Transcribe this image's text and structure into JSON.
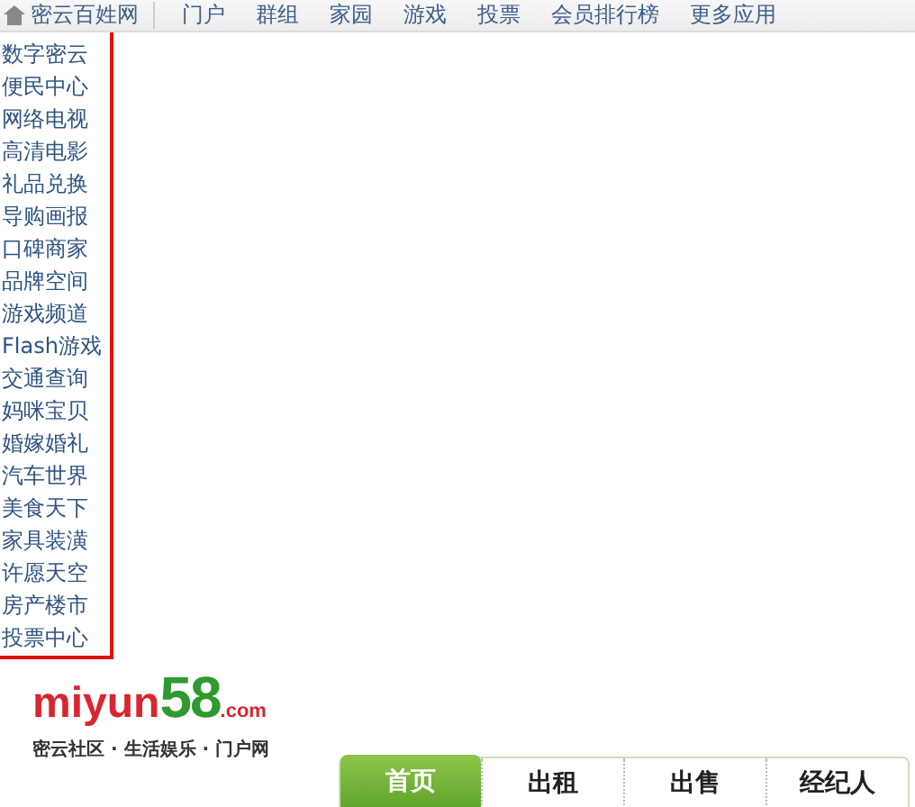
{
  "top_nav": {
    "site_name": "密云百姓网",
    "links": [
      "门户",
      "群组",
      "家园",
      "游戏",
      "投票",
      "会员排行榜",
      "更多应用"
    ]
  },
  "channel_list": [
    "数字密云",
    "便民中心",
    "网络电视",
    "高清电影",
    "礼品兑换",
    "导购画报",
    "口碑商家",
    "品牌空间",
    "游戏频道",
    "Flash游戏",
    "交通查询",
    "妈咪宝贝",
    "婚嫁婚礼",
    "汽车世界",
    "美食天下",
    "家具装潢",
    "许愿天空",
    "房产楼市",
    "投票中心"
  ],
  "logo": {
    "name_part": "miyun",
    "number_part": "58",
    "domain_part": ".com",
    "tagline": "密云社区 · 生活娱乐 · 门户网"
  },
  "tabs": [
    {
      "label": "首页",
      "selected": true
    },
    {
      "label": "出租",
      "selected": false
    },
    {
      "label": "出售",
      "selected": false
    },
    {
      "label": "经纪人",
      "selected": false
    }
  ]
}
